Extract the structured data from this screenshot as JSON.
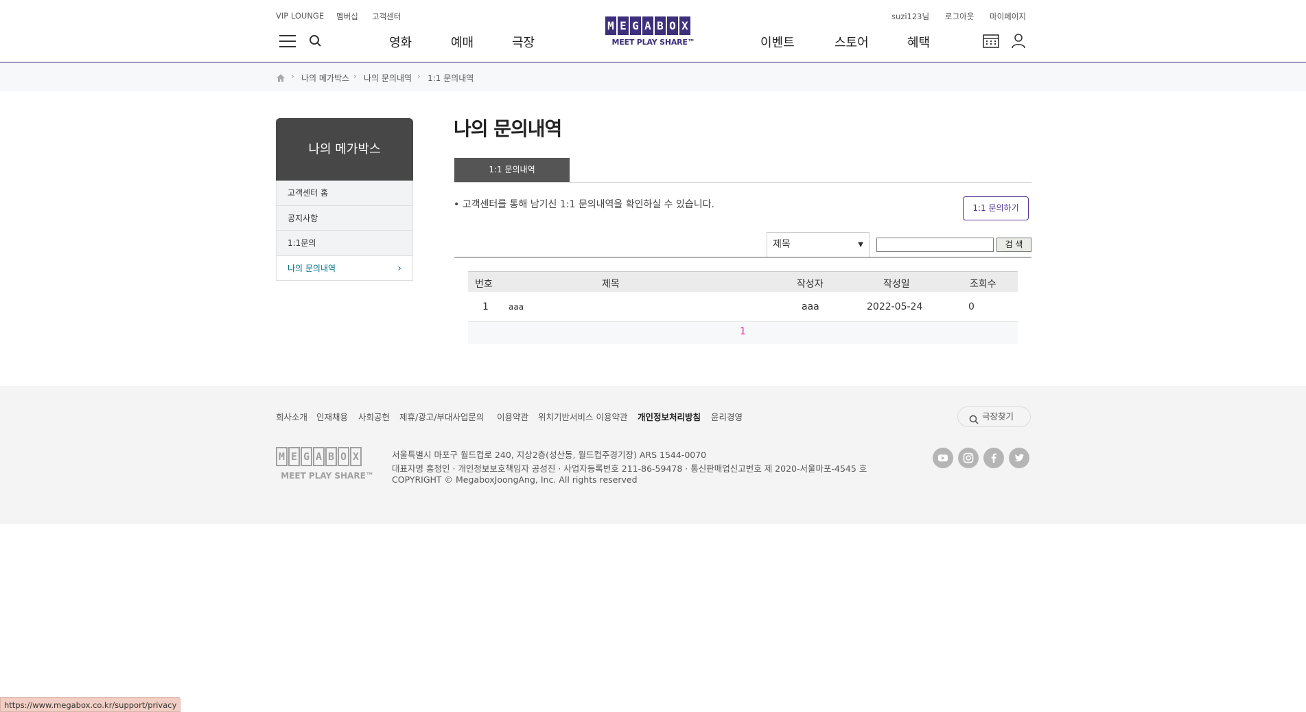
{
  "header": {
    "util_left": [
      "VIP LOUNGE",
      "멤버십",
      "고객센터"
    ],
    "util_right": [
      "suzi123님",
      "로그아웃",
      "마이페이지"
    ],
    "gnb_left": [
      "영화",
      "예매",
      "극장"
    ],
    "gnb_right": [
      "이벤트",
      "스토어",
      "혜택"
    ],
    "logo_letters": [
      "M",
      "E",
      "G",
      "A",
      "B",
      "O",
      "X"
    ],
    "logo_tagline": "MEET PLAY SHARE™",
    "icons": [
      "menu-icon",
      "search-icon",
      "calendar-icon",
      "user-icon"
    ]
  },
  "breadcrumb": [
    "나의 메가박스",
    "나의 문의내역",
    "1:1 문의내역"
  ],
  "lnb": {
    "title": "나의 메가박스",
    "items": [
      {
        "label": "고객센터 홈",
        "active": false
      },
      {
        "label": "공지사항",
        "active": false
      },
      {
        "label": "1:1문의",
        "active": false
      },
      {
        "label": "나의 문의내역",
        "active": true
      }
    ]
  },
  "content": {
    "title": "나의 문의내역",
    "tab": "1:1 문의내역",
    "info": "• 고객센터를 통해 남기신 1:1 문의내역을 확인하실 수 있습니다.",
    "ask_button": "1:1 문의하기",
    "search": {
      "select_value": "제목",
      "input_value": "",
      "button": "검 색"
    },
    "table": {
      "headers": [
        "번호",
        "제목",
        "작성자",
        "작성일",
        "조회수"
      ],
      "rows": [
        {
          "no": "1",
          "title": "aaa",
          "author": "aaa",
          "date": "2022-05-24",
          "views": "0"
        }
      ],
      "page": "1"
    }
  },
  "footer": {
    "links": [
      "회사소개",
      "인재채용",
      "사회공헌",
      "제휴/광고/부대사업문의",
      "이용약관",
      "위치기반서비스 이용약관",
      "개인정보처리방침",
      "윤리경영"
    ],
    "theater_button": "극장찾기",
    "address": "서울특별시 마포구 월드컵로 240, 지상2층(성산동, 월드컵주경기장) ARS 1544-0070",
    "company": "대표자명 홍정인 · 개인정보보호책임자 공성진 · 사업자등록번호 211-86-59478 · 통신판매업신고번호 제 2020-서울마포-4545 호",
    "copyright": "COPYRIGHT © MegaboxJoongAng, Inc. All rights reserved",
    "logo_letters": [
      "M",
      "E",
      "G",
      "A",
      "B",
      "O",
      "X"
    ],
    "logo_tagline": "MEET PLAY SHARE™",
    "sns": [
      "youtube-icon",
      "instagram-icon",
      "facebook-icon",
      "twitter-icon"
    ]
  },
  "status_bar_url": "https://www.megabox.co.kr/support/privacy"
}
